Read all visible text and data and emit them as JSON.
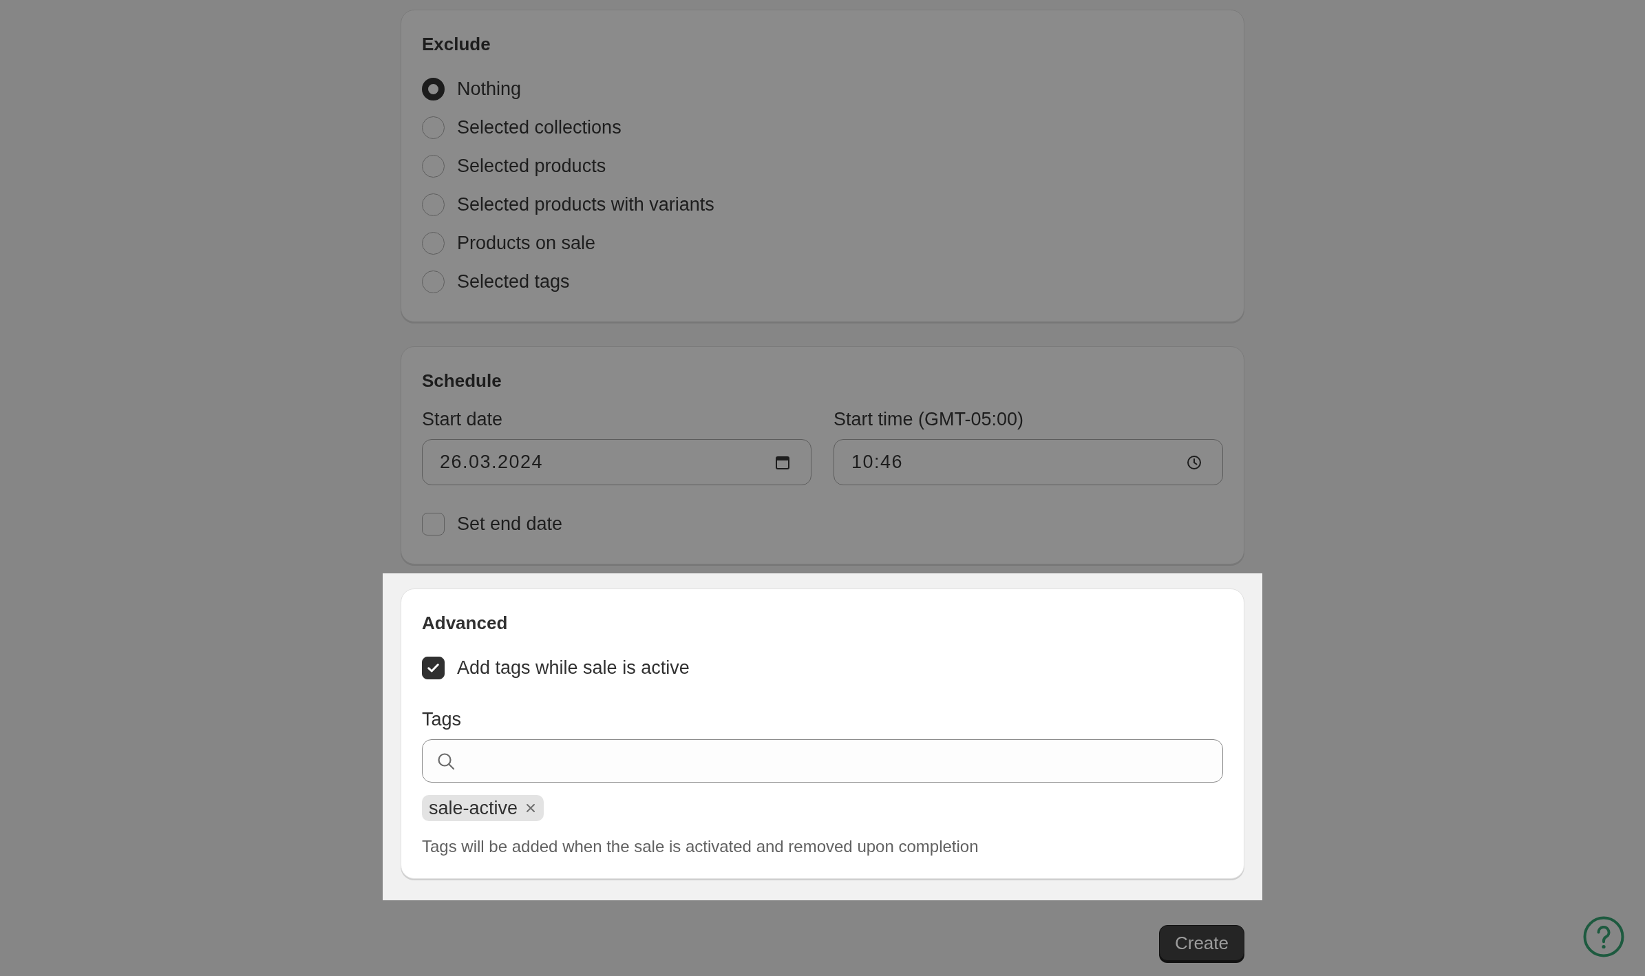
{
  "exclude": {
    "title": "Exclude",
    "dimmed": true,
    "options": [
      {
        "label": "Nothing",
        "selected": true
      },
      {
        "label": "Selected collections",
        "selected": false
      },
      {
        "label": "Selected products",
        "selected": false
      },
      {
        "label": "Selected products with variants",
        "selected": false
      },
      {
        "label": "Products on sale",
        "selected": false
      },
      {
        "label": "Selected tags",
        "selected": false
      }
    ]
  },
  "schedule": {
    "title": "Schedule",
    "dimmed": true,
    "start_date": {
      "label": "Start date",
      "value": "26.03.2024"
    },
    "start_time": {
      "label": "Start time (GMT-05:00)",
      "value": "10:46"
    },
    "set_end_date": {
      "label": "Set end date",
      "checked": false
    }
  },
  "advanced": {
    "title": "Advanced",
    "dimmed": false,
    "add_tags": {
      "label": "Add tags while sale is active",
      "checked": true
    },
    "tags": {
      "label": "Tags",
      "chips": [
        {
          "label": "sale-active"
        }
      ],
      "help": "Tags will be added when the sale is activated and removed upon completion"
    }
  },
  "create_button": {
    "label": "Create",
    "dimmed": true
  }
}
